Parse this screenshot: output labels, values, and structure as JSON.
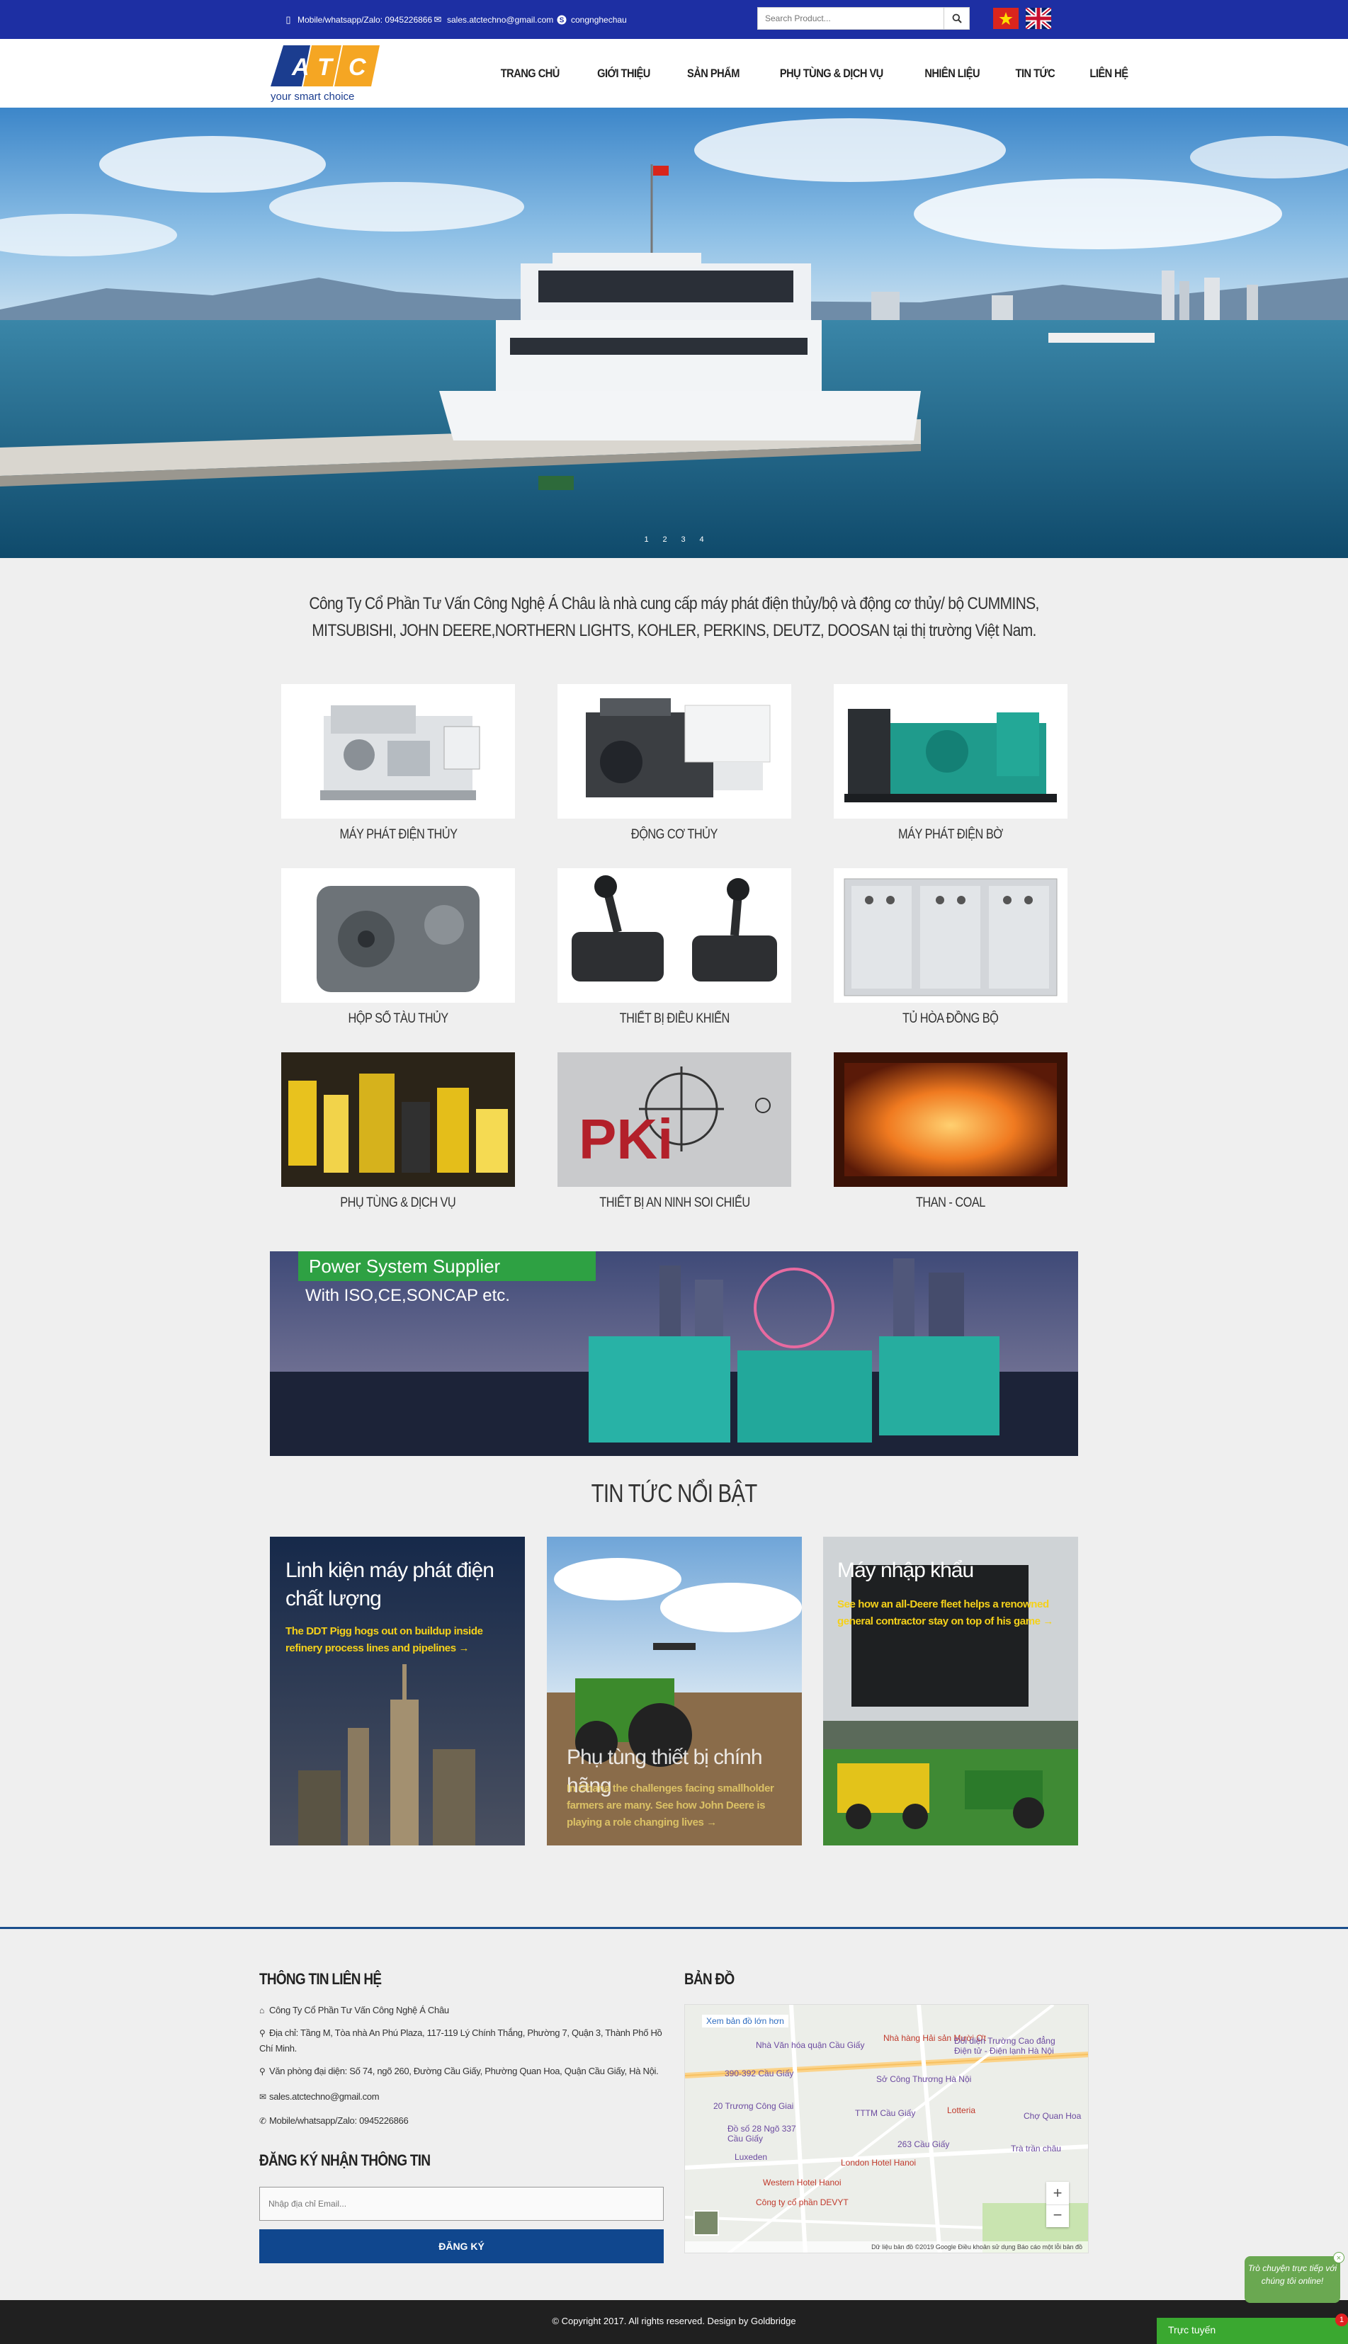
{
  "topbar": {
    "phone": "Mobile/whatsapp/Zalo: 0945226866",
    "email": "sales.atctechno@gmail.com",
    "skype": "congnghechau",
    "search_placeholder": "Search Product..."
  },
  "logo": {
    "letters": [
      "A",
      "T",
      "C"
    ],
    "tagline": "your smart choice"
  },
  "nav": [
    "TRANG CHỦ",
    "GIỚI THIỆU",
    "SẢN PHẨM",
    "PHỤ TÙNG & DỊCH VỤ",
    "NHIÊN LIỆU",
    "TIN TỨC",
    "LIÊN HỆ"
  ],
  "hero": {
    "dots": [
      "1",
      "2",
      "3",
      "4"
    ]
  },
  "intro": "Công Ty Cổ Phần Tư Vấn Công Nghệ Á Châu là nhà cung cấp máy phát điện thủy/bộ và động cơ thủy/ bộ CUMMINS, MITSUBISHI, JOHN DEERE,NORTHERN LIGHTS, KOHLER, PERKINS, DEUTZ, DOOSAN tại thị trường Việt Nam.",
  "products": [
    "MÁY PHÁT ĐIỆN THỦY",
    "ĐỘNG CƠ THỦY",
    "MÁY PHÁT ĐIỆN BỜ",
    "HỘP SỐ TÀU THỦY",
    "THIẾT BỊ ĐIỀU KHIỂN",
    "TỦ HÒA ĐỒNG BỘ",
    "PHỤ TÙNG & DỊCH VỤ",
    "THIẾT BỊ AN NINH SOI CHIẾU",
    "THAN - COAL"
  ],
  "pki_text": "PKi",
  "banner": {
    "line1": "Power System Supplier",
    "line2": "With ISO,CE,SONCAP etc."
  },
  "news_heading": "TIN TỨC NỔI BẬT",
  "news": [
    {
      "title": "Linh kiện máy phát điện chất lượng",
      "summary": "The DDT Pigg hogs out on buildup inside refinery process lines and pipelines →"
    },
    {
      "title": "Phụ tùng thiết bị chính hãng",
      "summary": "In Ghana the challenges facing smallholder farmers are many. See how John Deere is playing a role changing lives →"
    },
    {
      "title": "Máy nhập khẩu",
      "summary": "See how an all-Deere fleet helps a renowned general contractor stay on top of his game →"
    }
  ],
  "footer": {
    "contact_heading": "THÔNG TIN LIÊN HỆ",
    "company": "Công Ty Cổ Phần Tư Vấn Công Nghệ Á Châu",
    "address": "Địa chỉ: Tầng M, Tòa nhà An Phú Plaza, 117-119 Lý Chính Thắng, Phường 7, Quận 3, Thành Phố Hồ Chí Minh.",
    "office": "Văn phòng đại diện: Số 74, ngõ 260, Đường Cầu Giấy, Phường Quan Hoa, Quận Cầu Giấy, Hà Nội.",
    "email": "sales.atctechno@gmail.com",
    "phone": "Mobile/whatsapp/Zalo: 0945226866",
    "subscribe_heading": "ĐĂNG KÝ NHẬN THÔNG TIN",
    "email_placeholder": "Nhập địa chỉ Email...",
    "subscribe_button": "ĐĂNG KÝ",
    "map_heading": "BẢN ĐỒ",
    "map_link": "Xem bản đồ lớn hơn",
    "map_labels": [
      "Nhà Văn hóa quận Cầu Giấy",
      "Nhà hàng Hải sản Mười Ơt",
      "Đối diện Trường Cao đẳng Điện tử - Điện lạnh Hà Nội",
      "390-392 Cầu Giấy",
      "Sở Công Thương Hà Nội",
      "20 Trương Công Giai",
      "TTTM Cầu Giấy",
      "Lotteria",
      "Chợ Quan Hoa",
      "Đồ số 28 Ngõ 337 Cầu Giấy",
      "263 Cầu Giấy",
      "London Hotel Hanoi",
      "Western Hotel Hanoi",
      "Công ty cổ phần DEVYT",
      "Luxeden",
      "Trà trần châu"
    ],
    "map_footer": "Dữ liệu bản đồ ©2019 Google   Điều khoản sử dụng   Báo cáo một lỗi bản đồ",
    "copyright": "© Copyright 2017. All rights reserved. Design by Goldbridge"
  },
  "chat": {
    "bubble": "Trò chuyện trực tiếp với chúng tôi online!",
    "bar": "Trực tuyến",
    "badge": "1"
  }
}
